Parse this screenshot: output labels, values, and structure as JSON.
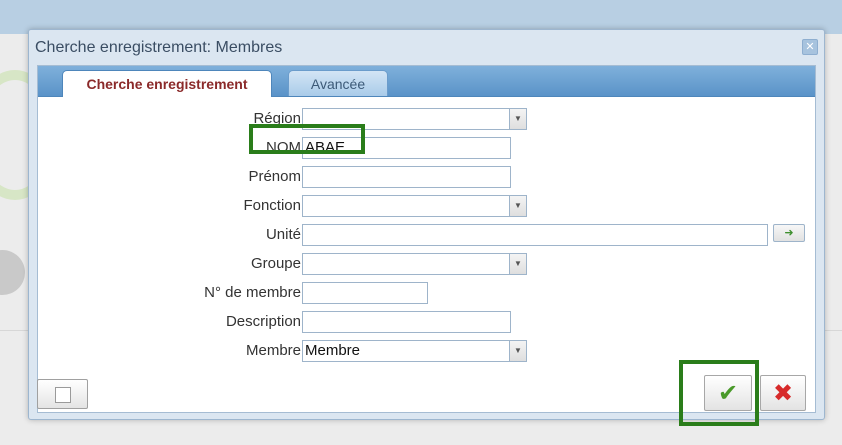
{
  "dialog": {
    "title": "Cherche enregistrement: Membres",
    "tabs": [
      {
        "label": "Cherche enregistrement",
        "active": true
      },
      {
        "label": "Avancée",
        "active": false
      }
    ]
  },
  "form": {
    "region": {
      "label": "Région",
      "value": ""
    },
    "nom": {
      "label": "NOM",
      "value": "ABAE"
    },
    "prenom": {
      "label": "Prénom",
      "value": ""
    },
    "fonction": {
      "label": "Fonction",
      "value": ""
    },
    "unite": {
      "label": "Unité",
      "value": ""
    },
    "groupe": {
      "label": "Groupe",
      "value": ""
    },
    "numero": {
      "label": "N° de membre",
      "value": ""
    },
    "description": {
      "label": "Description",
      "value": ""
    },
    "membre": {
      "label": "Membre",
      "value": "Membre"
    }
  },
  "icons": {
    "close": "close-icon",
    "dropdown": "chevron-down-icon",
    "ok": "check-icon",
    "cancel": "x-icon",
    "new": "page-icon",
    "go": "arrow-icon"
  },
  "colors": {
    "highlight": "#2a7d1a",
    "tab_active_text": "#8b2a2a",
    "ok_check": "#4a9a2a",
    "cancel_x": "#d72a2a"
  }
}
